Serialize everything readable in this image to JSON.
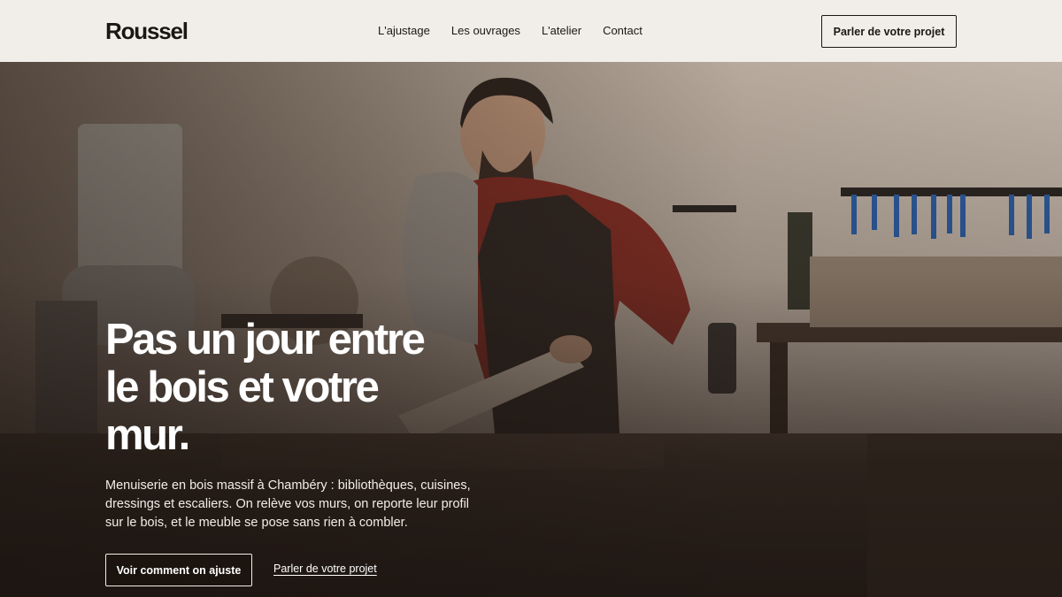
{
  "brand": {
    "name": "Roussel"
  },
  "nav": {
    "items": [
      {
        "label": "L'ajustage"
      },
      {
        "label": "Les ouvrages"
      },
      {
        "label": "L'atelier"
      },
      {
        "label": "Contact"
      }
    ],
    "cta_label": "Parler de votre projet"
  },
  "hero": {
    "headline_lines": [
      "Pas un jour entre",
      "le bois et votre",
      "mur."
    ],
    "lede": "Menuiserie en bois massif à Chambéry : bibliothèques, cuisines, dressings et escaliers. On relève vos murs, on reporte leur profil sur le bois, et le meuble se pose sans rien à combler.",
    "primary_button": "Voir comment on ajuste",
    "secondary_link": "Parler de votre projet",
    "image_description_icon": "workshop-photo"
  },
  "colors": {
    "header_bg": "#f1eeea",
    "text_dark": "#1b1714",
    "hero_text": "#ffffff"
  }
}
